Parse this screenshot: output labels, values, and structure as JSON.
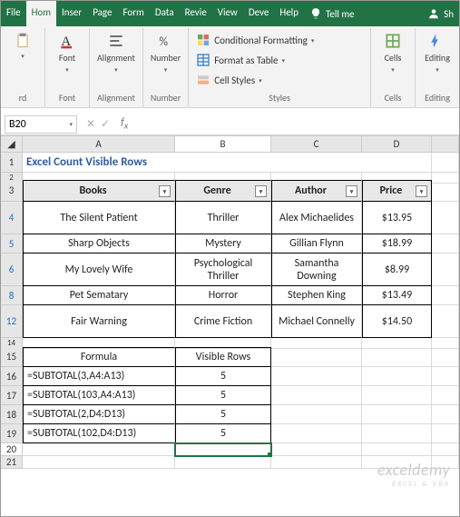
{
  "tabs": [
    "File",
    "Hom",
    "Inser",
    "Page",
    "Form",
    "Data",
    "Revie",
    "View",
    "Deve",
    "Help"
  ],
  "active_tab": 1,
  "tellme": "Tell me",
  "share": "Sh",
  "ribbon": {
    "rd": "rd",
    "font": "Font",
    "alignment": "Alignment",
    "number": "Number",
    "cond_fmt": "Conditional Formatting",
    "fmt_table": "Format as Table",
    "cell_styles": "Cell Styles",
    "styles": "Styles",
    "cells": "Cells",
    "editing": "Editing"
  },
  "name_box": "B20",
  "formula_bar": "",
  "columns": [
    "A",
    "B",
    "C",
    "D"
  ],
  "title_text": "Excel Count Visible Rows",
  "table_headers": [
    "Books",
    "Genre",
    "Author",
    "Price"
  ],
  "data_rows": [
    {
      "rn": "4",
      "books": "The Silent Patient",
      "genre": "Thriller",
      "author": "Alex Michaelides",
      "price": "$13.95"
    },
    {
      "rn": "5",
      "books": "Sharp Objects",
      "genre": "Mystery",
      "author": "Gillian Flynn",
      "price": "$18.99"
    },
    {
      "rn": "6",
      "books": "My Lovely Wife",
      "genre": "Psychological Thriller",
      "author": "Samantha Downing",
      "price": "$8.99"
    },
    {
      "rn": "8",
      "books": "Pet Sematary",
      "genre": "Horror",
      "author": "Stephen King",
      "price": "$13.49"
    },
    {
      "rn": "12",
      "books": "Fair Warning",
      "genre": "Crime Fiction",
      "author": "Michael Connelly",
      "price": "$14.50"
    }
  ],
  "formula_header": {
    "a": "Formula",
    "b": "Visible Rows"
  },
  "formulas": [
    {
      "rn": "16",
      "f": "=SUBTOTAL(3,A4:A13)",
      "v": "5"
    },
    {
      "rn": "17",
      "f": "=SUBTOTAL(103,A4:A13)",
      "v": "5"
    },
    {
      "rn": "18",
      "f": "=SUBTOTAL(2,D4:D13)",
      "v": "5"
    },
    {
      "rn": "19",
      "f": "=SUBTOTAL(102,D4:D13)",
      "v": "5"
    }
  ],
  "watermark": "exceldemy",
  "watermark_sub": "EXCEL & VBA"
}
